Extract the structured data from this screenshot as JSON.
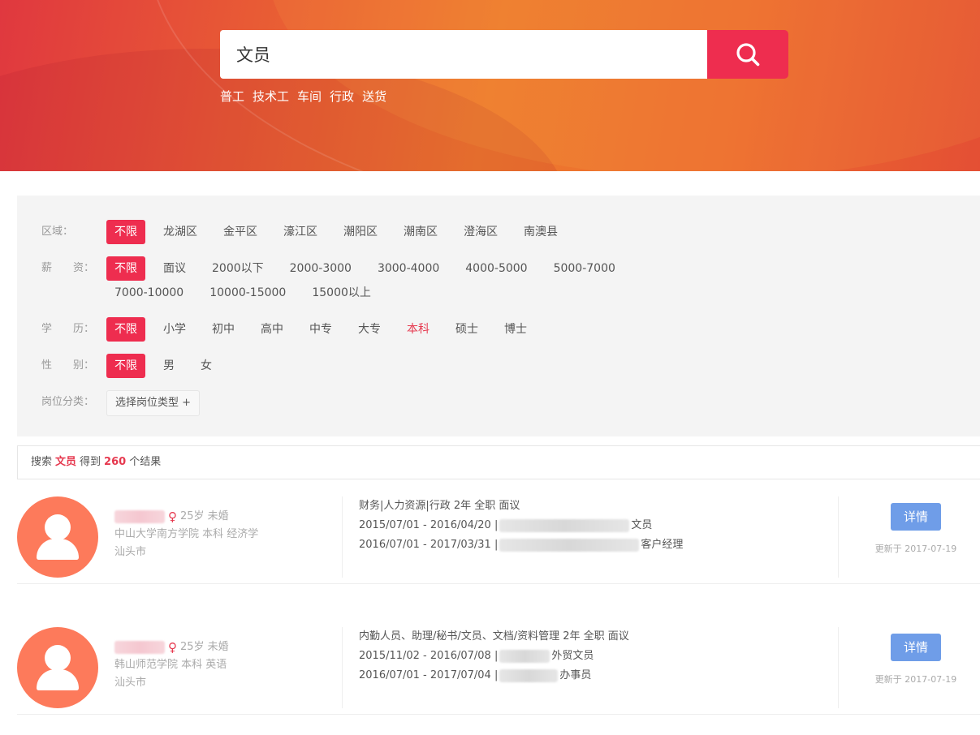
{
  "search": {
    "query": "文员",
    "hot_keywords": [
      "普工",
      "技术工",
      "车间",
      "行政",
      "送货"
    ]
  },
  "filters": {
    "area": {
      "label": "区域：",
      "options": [
        "不限",
        "龙湖区",
        "金平区",
        "濠江区",
        "潮阳区",
        "潮南区",
        "澄海区",
        "南澳县"
      ]
    },
    "salary": {
      "label": "薪　　资：",
      "options": [
        "不限",
        "面议",
        "2000以下",
        "2000-3000",
        "3000-4000",
        "4000-5000",
        "5000-7000",
        "7000-10000",
        "10000-15000",
        "15000以上"
      ]
    },
    "education": {
      "label": "学　　历：",
      "options": [
        "不限",
        "小学",
        "初中",
        "高中",
        "中专",
        "大专",
        "本科",
        "硕士",
        "博士"
      ]
    },
    "gender": {
      "label": "性　　别：",
      "options": [
        "不限",
        "男",
        "女"
      ]
    },
    "category": {
      "label": "岗位分类：",
      "button": "选择岗位类型 +"
    }
  },
  "summary": {
    "prefix": "搜索",
    "keyword": "文员",
    "middle": "得到",
    "count": "260",
    "suffix": "个结果"
  },
  "results": [
    {
      "age_marital": "25岁 未婚",
      "school_line": "中山大学南方学院 本科 经济学",
      "city": "汕头市",
      "intent": "财务|人力资源|行政 2年 全职 面议",
      "exp1_date": "2015/07/01 - 2016/04/20 |",
      "exp1_title": "文员",
      "exp2_date": "2016/07/01 - 2017/03/31 |",
      "exp2_title": "客户经理",
      "detail": "详情",
      "updated": "更新于 2017-07-19"
    },
    {
      "age_marital": "25岁 未婚",
      "school_line": "韩山师范学院 本科 英语",
      "city": "汕头市",
      "intent": "内勤人员、助理/秘书/文员、文档/资料管理 2年 全职 面议",
      "exp1_date": "2015/11/02 - 2016/07/08 |",
      "exp1_title": "外贸文员",
      "exp2_date": "2016/07/01 - 2017/07/04 |",
      "exp2_title": "办事员",
      "detail": "详情",
      "updated": "更新于 2017-07-19"
    }
  ],
  "colors": {
    "accent": "#ee2d4f",
    "detail_button": "#6f9de8",
    "avatar": "#fd7a5b"
  }
}
